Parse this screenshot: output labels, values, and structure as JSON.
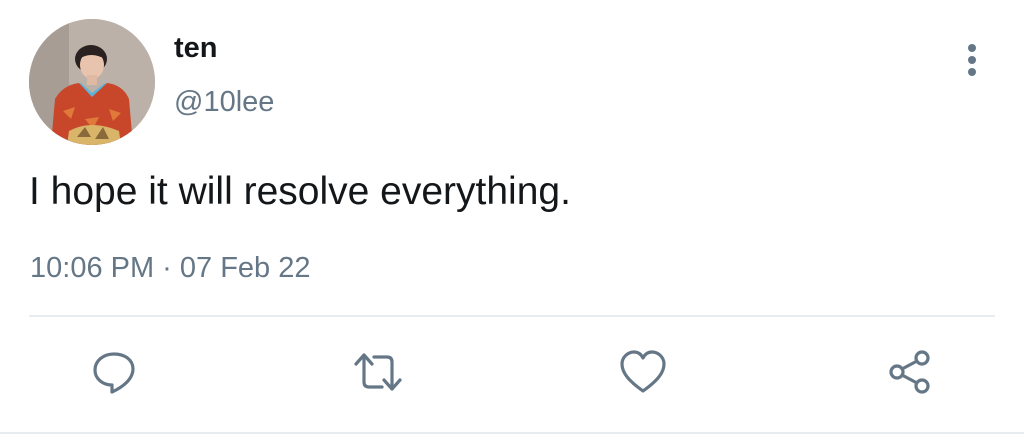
{
  "tweet": {
    "display_name": "ten",
    "handle": "@10lee",
    "text": "I hope it will resolve everything.",
    "timestamp": "10:06 PM · 07 Feb 22"
  },
  "icons": {
    "more": "more-vertical-icon",
    "reply": "reply-icon",
    "retweet": "retweet-icon",
    "like": "heart-icon",
    "share": "share-icon"
  },
  "colors": {
    "text_primary": "#14171a",
    "text_secondary": "#657786",
    "icon": "#657786",
    "divider": "#e6ecf0"
  }
}
